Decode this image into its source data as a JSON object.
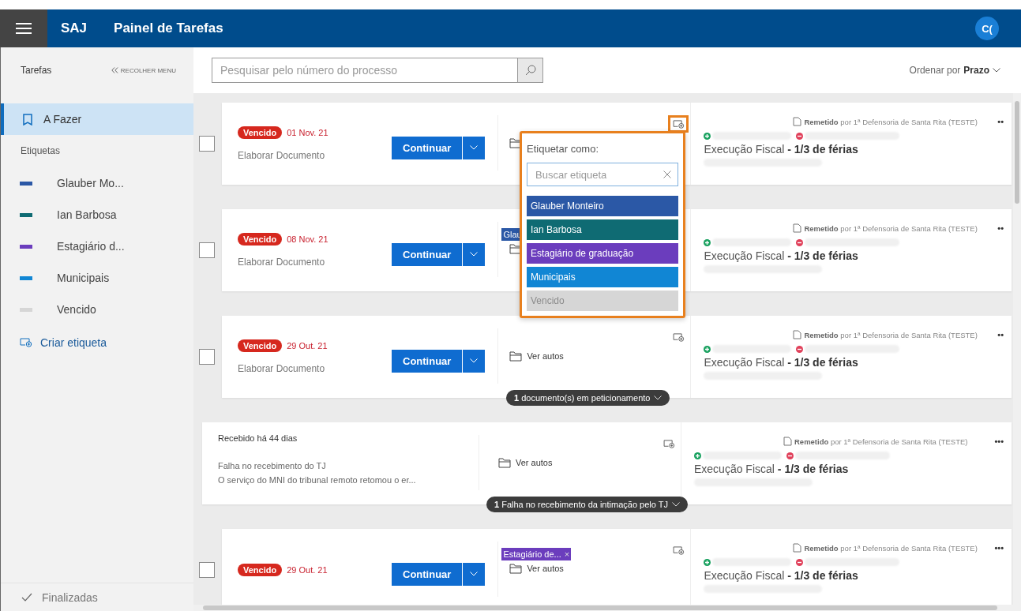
{
  "header": {
    "app": "SAJ",
    "title": "Painel de Tarefas",
    "avatar": "C("
  },
  "sidebar": {
    "title": "Tarefas",
    "collapse": "RECOLHER MENU",
    "todo": {
      "label": "A Fazer",
      "selected": true
    },
    "labels_heading": "Etiquetas",
    "labels": [
      {
        "label": "Glauber Mo...",
        "color": "#2b58a6"
      },
      {
        "label": "Ian Barbosa",
        "color": "#0f6b73"
      },
      {
        "label": "Estagiário d...",
        "color": "#6b3dbd"
      },
      {
        "label": "Municipais",
        "color": "#1186d4"
      },
      {
        "label": "Vencido",
        "color": "#d6d6d6"
      }
    ],
    "create_label": "Criar etiqueta",
    "done": {
      "label": "Finalizadas",
      "selected": false
    }
  },
  "search": {
    "placeholder": "Pesquisar pelo número do processo"
  },
  "sort": {
    "label": "Ordenar por",
    "value": "Prazo"
  },
  "cards": [
    {
      "kind": "task",
      "checked": false,
      "status": "Vencido",
      "date": "01 Nov. 21",
      "action": "Elaborar Documento",
      "button": "Continuar",
      "tag_menu_open": true,
      "sender": "**Remetido** por 1ª Defensoria de Santa Rita (TESTE)",
      "more": "••",
      "subject": "Execução Fiscal **- 1/3 de férias**"
    },
    {
      "kind": "task",
      "checked": false,
      "status": "Vencido",
      "date": "08 Nov. 21",
      "action": "Elaborar Documento",
      "button": "Continuar",
      "tag": {
        "label": "Glau",
        "color": "#2b58a6"
      },
      "sender": "**Remetido** por 1ª Defensoria de Santa Rita (TESTE)",
      "more": "••",
      "subject": "Execução Fiscal **- 1/3 de férias**"
    },
    {
      "kind": "task",
      "checked": false,
      "status": "Vencido",
      "date": "29 Out. 21",
      "action": "Elaborar Documento",
      "button": "Continuar",
      "folder_label": "Ver autos",
      "tag_menu_open": false,
      "sender": "**Remetido** por 1ª Defensoria de Santa Rita (TESTE)",
      "more": "••",
      "subject": "Execução Fiscal **- 1/3 de férias**",
      "pill": "**1** documento(s) em peticionamento"
    },
    {
      "kind": "notice",
      "received": "Recebido há 44 dias",
      "lines": [
        "Falha no recebimento do TJ",
        "O serviço do MNI do tribunal remoto retomou o er..."
      ],
      "folder_label": "Ver autos",
      "tag_menu_open": false,
      "sender": "**Remetido** por 1ª Defensoria de Santa Rita (TESTE)",
      "more": "•••",
      "subject": "Execução Fiscal **- 1/3 de férias**",
      "pill": "**1** Falha no recebimento da intimação pelo TJ"
    },
    {
      "kind": "task",
      "checked": false,
      "status": "Vencido",
      "date": "29 Out. 21",
      "button": "Continuar",
      "tag": {
        "label": "Estagiário de...",
        "color": "#6b3dbd",
        "remove": "×"
      },
      "folder_label": "Ver autos",
      "tag_menu_open": false,
      "sender": "**Remetido** por 1ª Defensoria de Santa Rita (TESTE)",
      "more": "•••",
      "subject": "Execução Fiscal **- 1/3 de férias**"
    }
  ],
  "tag_menu": {
    "title": "Etiquetar como:",
    "search_placeholder": "Buscar etiqueta",
    "options": [
      {
        "label": "Glauber Monteiro",
        "color": "#2b58a6",
        "disabled": false
      },
      {
        "label": "Ian Barbosa",
        "color": "#0f6b73",
        "disabled": false
      },
      {
        "label": "Estagiário de graduação",
        "color": "#6b3dbd",
        "disabled": false
      },
      {
        "label": "Municipais",
        "color": "#1186d4",
        "disabled": false
      },
      {
        "label": "Vencido",
        "color": "#d6d6d6",
        "disabled": true
      }
    ]
  }
}
